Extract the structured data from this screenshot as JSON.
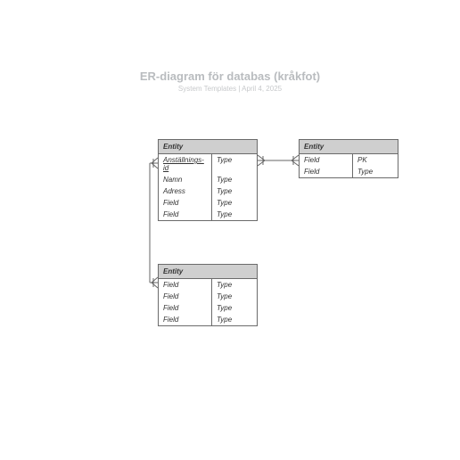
{
  "header": {
    "title": "ER-diagram för databas (kråkfot)",
    "subtitle": "System Templates  |  April 4, 2025"
  },
  "entities": {
    "e1": {
      "title": "Entity",
      "rows": [
        {
          "field": "Anställnings-id",
          "type": "Type",
          "underline": true
        },
        {
          "field": "Namn",
          "type": "Type"
        },
        {
          "field": "Adress",
          "type": "Type"
        },
        {
          "field": "Field",
          "type": "Type"
        },
        {
          "field": "Field",
          "type": "Type"
        }
      ]
    },
    "e2": {
      "title": "Entity",
      "rows": [
        {
          "field": "Field",
          "type": "PK"
        },
        {
          "field": "Field",
          "type": "Type"
        }
      ]
    },
    "e3": {
      "title": "Entity",
      "rows": [
        {
          "field": "Field",
          "type": "Type"
        },
        {
          "field": "Field",
          "type": "Type"
        },
        {
          "field": "Field",
          "type": "Type"
        },
        {
          "field": "Field",
          "type": "Type"
        }
      ]
    }
  }
}
